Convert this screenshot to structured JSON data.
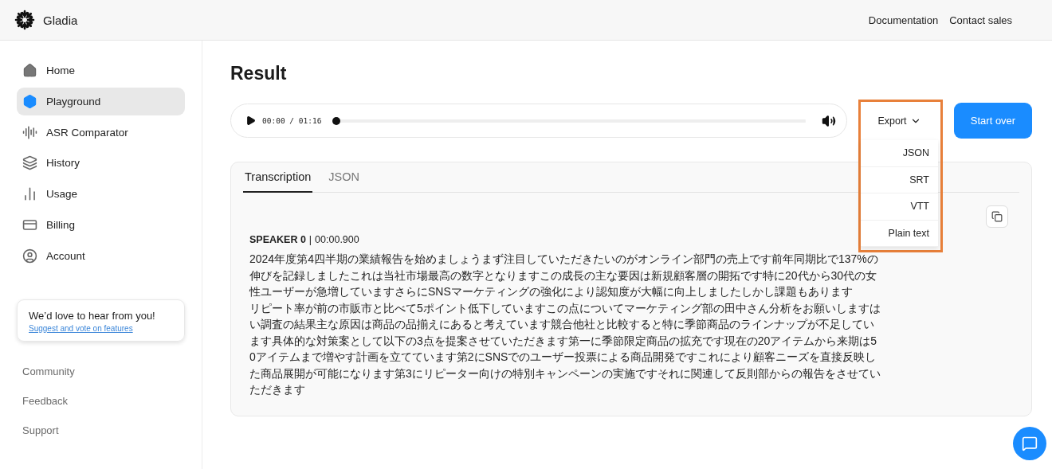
{
  "header": {
    "brand": "Gladia",
    "links": [
      "Documentation",
      "Contact sales"
    ]
  },
  "sidebar": {
    "items": [
      {
        "label": "Home",
        "selected": false
      },
      {
        "label": "Playground",
        "selected": true
      },
      {
        "label": "ASR Comparator",
        "selected": false
      },
      {
        "label": "History",
        "selected": false
      },
      {
        "label": "Usage",
        "selected": false
      },
      {
        "label": "Billing",
        "selected": false
      },
      {
        "label": "Account",
        "selected": false
      }
    ],
    "feedback_card": {
      "title": "We’d love to hear from you!",
      "link": "Suggest and vote on features"
    },
    "footer_links": [
      "Community",
      "Feedback",
      "Support"
    ]
  },
  "page": {
    "title": "Result"
  },
  "player": {
    "time": "00:00 / 01:16",
    "level": 0
  },
  "export": {
    "label": "Export",
    "expanded": true,
    "highlighted": true,
    "options": [
      "JSON",
      "SRT",
      "VTT",
      "Plain text"
    ]
  },
  "start_over": "Start over",
  "tabs": [
    {
      "label": "Transcription",
      "selected": true
    },
    {
      "label": "JSON",
      "selected": false
    }
  ],
  "segment": {
    "speaker": "SPEAKER 0",
    "separator": "|",
    "time": "00:00.900",
    "paragraphs": [
      "2024年度第4四半期の業績報告を始めましょうまず注目していただきたいのがオンライン部門の売上です前年同期比で137%の伸びを記録しましたこれは当社市場最高の数字となりますこの成長の主な要因は新規顧客層の開拓です特に20代から30代の女性ユーザーが急増していますさらにSNSマーケティングの強化により認知度が大幅に向上しましたしかし課題もあります",
      "リピート率が前の市販市と比べて5ポイント低下していますこの点についてマーケティング部の田中さん分析をお願いしますはい調査の結果主な原因は商品の品揃えにあると考えています競合他社と比較すると特に季節商品のラインナップが不足しています具体的な対策案として以下の3点を提案させていただきます第一に季節限定商品の拡充です現在の20アイテムから来期は50アイテムまで増やす計画を立てています第2にSNSでのユーザー投票による商品開発ですこれにより顧客ニーズを直接反映した商品展開が可能になります第3にリピーター向けの特別キャンペーンの実施ですそれに関連して反則部からの報告をさせていただきます"
    ]
  }
}
